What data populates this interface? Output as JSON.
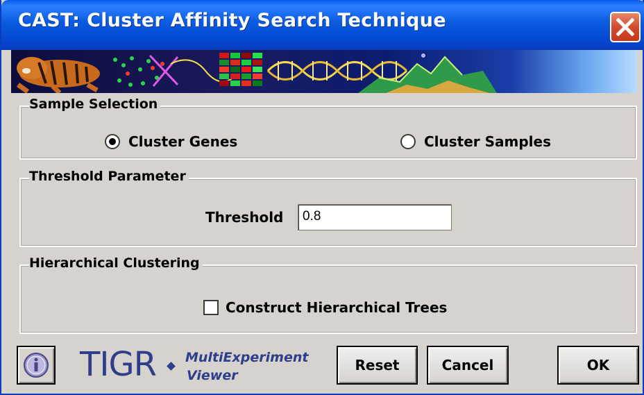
{
  "window": {
    "title": "CAST: Cluster Affinity Search Technique"
  },
  "sample_selection": {
    "title": "Sample Selection",
    "options": [
      {
        "label": "Cluster Genes",
        "selected": true
      },
      {
        "label": "Cluster Samples",
        "selected": false
      }
    ]
  },
  "threshold_parameter": {
    "title": "Threshold Parameter",
    "label": "Threshold",
    "value": "0.8"
  },
  "hierarchical_clustering": {
    "title": "Hierarchical Clustering",
    "checkbox_label": "Construct Hierarchical Trees",
    "checked": false
  },
  "footer": {
    "logo_text": "TIGR",
    "logo_sub_line1": "MultiExperiment",
    "logo_sub_line2": "Viewer",
    "reset_label": "Reset",
    "cancel_label": "Cancel",
    "ok_label": "OK"
  },
  "colors": {
    "titlebar": "#0a5ae0",
    "dialog_bg": "#d6d3ce",
    "close_button": "#d24b2c",
    "logo_text": "#2e3e8a"
  },
  "icons": [
    "close-icon",
    "info-icon",
    "banner-image"
  ]
}
